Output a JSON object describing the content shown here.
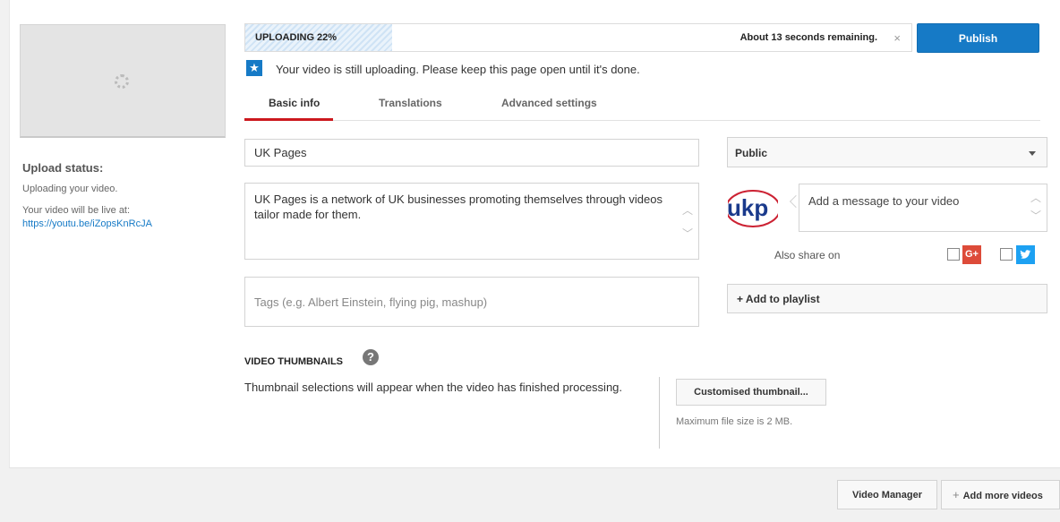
{
  "upload": {
    "progress_label": "UPLOADING 22%",
    "progress_fraction": 0.22,
    "remaining": "About 13 seconds remaining.",
    "close_glyph": "×",
    "publish_label": "Publish",
    "notice_icon": "star-icon",
    "notice": "Your video is still uploading. Please keep this page open until it's done."
  },
  "sidebar": {
    "status_title": "Upload status:",
    "status_text": "Uploading your video.",
    "live_at_label": "Your video will be live at:",
    "live_url": "https://youtu.be/iZopsKnRcJA"
  },
  "tabs": [
    {
      "label": "Basic info",
      "active": true
    },
    {
      "label": "Translations",
      "active": false
    },
    {
      "label": "Advanced settings",
      "active": false
    }
  ],
  "form": {
    "title_value": "UK Pages",
    "description_value": "UK Pages is a network of UK businesses promoting themselves through videos tailor made for them.",
    "tags_placeholder": "Tags (e.g. Albert Einstein, flying pig, mashup)"
  },
  "share": {
    "privacy_value": "Public",
    "message_placeholder": "Add a message to your video",
    "also_share_label": "Also share on",
    "gplus_glyph": "G+",
    "playlist_label": "+ Add to playlist"
  },
  "thumbnails": {
    "title": "VIDEO THUMBNAILS",
    "help_glyph": "?",
    "note": "Thumbnail selections will appear when the video has finished processing.",
    "custom_button": "Customised thumbnail...",
    "max_size": "Maximum file size is 2 MB."
  },
  "footer": {
    "video_manager": "Video Manager",
    "add_more": "Add more videos",
    "add_more_glyph": "+"
  },
  "colors": {
    "accent": "#167ac6",
    "tab_active": "#cc181e",
    "gplus": "#dd4b39",
    "twitter": "#1da1f2"
  }
}
